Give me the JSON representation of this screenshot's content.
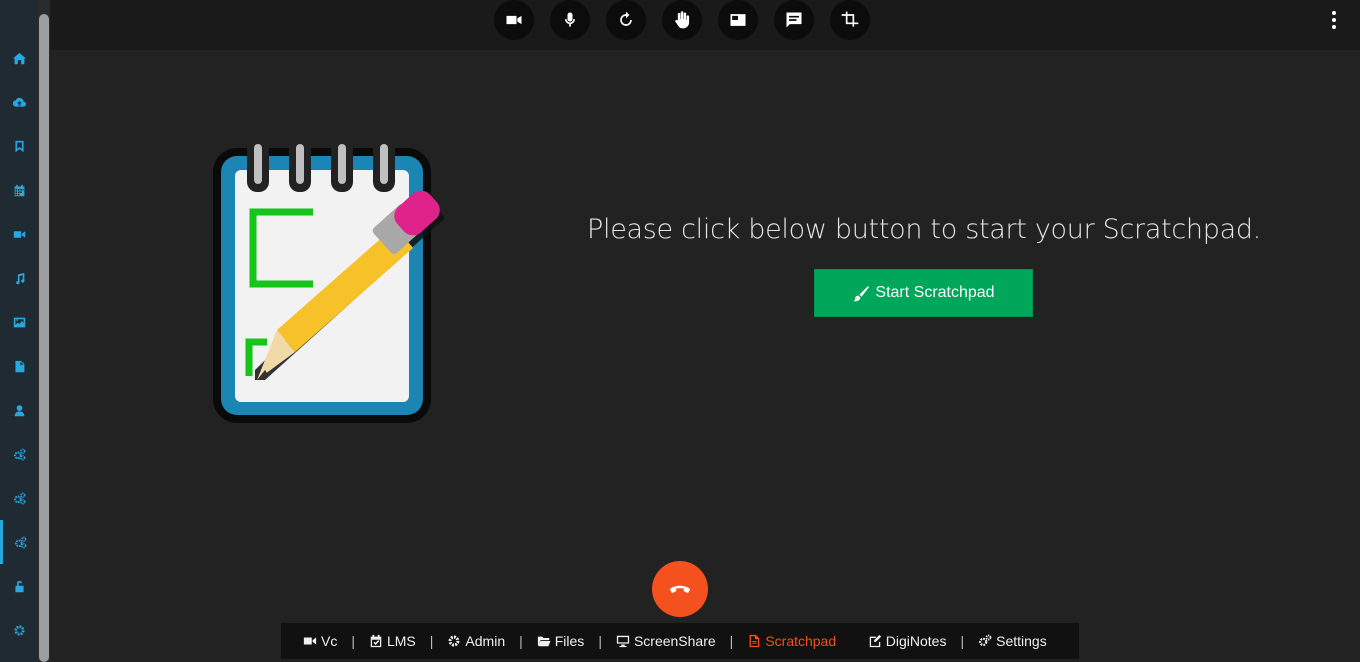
{
  "sidebar": {
    "items": [
      {
        "icon": "home-icon"
      },
      {
        "icon": "cloud-upload-icon"
      },
      {
        "icon": "bookmark-icon"
      },
      {
        "icon": "calendar-icon"
      },
      {
        "icon": "video-icon"
      },
      {
        "icon": "music-icon"
      },
      {
        "icon": "image-icon"
      },
      {
        "icon": "file-icon"
      },
      {
        "icon": "user-icon"
      },
      {
        "icon": "cogs-icon"
      },
      {
        "icon": "cogs-icon"
      },
      {
        "icon": "cogs-icon"
      },
      {
        "icon": "unlock-icon"
      },
      {
        "icon": "gear-icon"
      }
    ],
    "accent_color": "#29a8e0"
  },
  "toolbar": {
    "buttons": [
      "camera-icon",
      "microphone-icon",
      "refresh-icon",
      "raise-hand-icon",
      "screen-icon",
      "chat-icon",
      "crop-icon"
    ],
    "menu_icon": "more-vertical-icon"
  },
  "main": {
    "prompt_text": "Please click below button to start your Scratchpad.",
    "start_button_label": "Start Scratchpad",
    "start_button_color": "#00a65a",
    "illustration": "notepad-pencil-icon"
  },
  "hangup": {
    "icon": "phone-hangup-icon",
    "color": "#f4511e"
  },
  "bottom_tabs": [
    {
      "label": "Vc",
      "icon": "video-icon"
    },
    {
      "label": "LMS",
      "icon": "calendar-check-icon"
    },
    {
      "label": "Admin",
      "icon": "gear-icon"
    },
    {
      "label": "Files",
      "icon": "folder-open-icon"
    },
    {
      "label": "ScreenShare",
      "icon": "desktop-icon"
    },
    {
      "label": "Scratchpad",
      "icon": "file-text-icon",
      "active": true
    },
    {
      "label": "DigiNotes",
      "icon": "edit-icon"
    },
    {
      "label": "Settings",
      "icon": "cogs-icon"
    }
  ],
  "active_tab_color": "#f4511e"
}
